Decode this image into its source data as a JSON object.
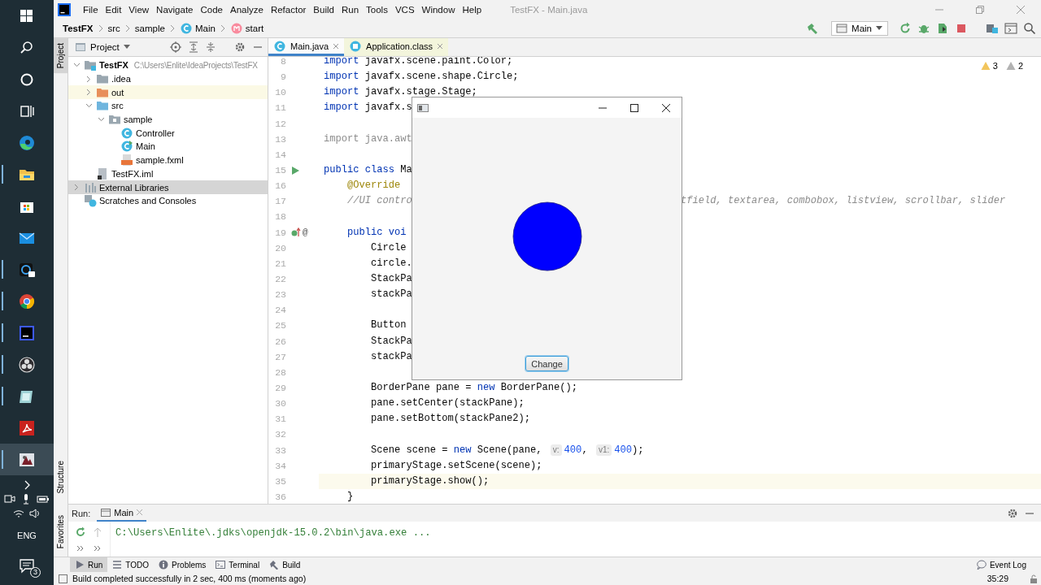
{
  "taskbar": {
    "items": [
      {
        "kind": "start",
        "running": false,
        "selected": false
      },
      {
        "kind": "search",
        "running": false,
        "selected": false
      },
      {
        "kind": "assistant",
        "running": false,
        "selected": false
      },
      {
        "kind": "task-view",
        "running": false,
        "selected": false
      },
      {
        "kind": "browser-edge",
        "running": false,
        "selected": false
      },
      {
        "kind": "explorer",
        "running": true,
        "selected": false
      },
      {
        "kind": "store",
        "running": false,
        "selected": false
      },
      {
        "kind": "mail",
        "running": false,
        "selected": false
      },
      {
        "kind": "chat",
        "running": true,
        "selected": false
      },
      {
        "kind": "browser-chrome",
        "running": true,
        "selected": false
      },
      {
        "kind": "ide",
        "running": true,
        "selected": false
      },
      {
        "kind": "recorder",
        "running": true,
        "selected": false
      },
      {
        "kind": "notes",
        "running": true,
        "selected": false
      },
      {
        "kind": "pdf",
        "running": false,
        "selected": false
      },
      {
        "kind": "java-app",
        "running": true,
        "selected": true
      }
    ],
    "language": "ENG",
    "notifications": "3"
  },
  "menubar": {
    "menus": [
      "File",
      "Edit",
      "View",
      "Navigate",
      "Code",
      "Analyze",
      "Refactor",
      "Build",
      "Run",
      "Tools",
      "VCS",
      "Window",
      "Help"
    ],
    "title": "TestFX - Main.java"
  },
  "navbar": {
    "breadcrumbs": [
      {
        "kind": "project",
        "label": "TestFX"
      },
      {
        "kind": "folder",
        "label": "src"
      },
      {
        "kind": "folder",
        "label": "sample"
      },
      {
        "kind": "class",
        "label": "Main"
      },
      {
        "kind": "method",
        "label": "start"
      }
    ],
    "run_config": "Main"
  },
  "left_stripe": [
    {
      "label": "Project",
      "selected": true
    },
    {
      "label": "Structure",
      "selected": false
    },
    {
      "label": "Favorites",
      "selected": false
    }
  ],
  "project": {
    "title": "Project",
    "tree": [
      {
        "kind": "module",
        "label": "TestFX",
        "path": "C:\\Users\\Enlite\\IdeaProjects\\TestFX",
        "expanded": true,
        "selected": false,
        "children": [
          {
            "kind": "folder",
            "label": ".idea",
            "expanded": false,
            "selected": false
          },
          {
            "kind": "excluded",
            "label": "out",
            "expanded": false,
            "selected": false
          },
          {
            "kind": "source",
            "label": "src",
            "expanded": true,
            "selected": false,
            "children": [
              {
                "kind": "package",
                "label": "sample",
                "expanded": true,
                "selected": false,
                "children": [
                  {
                    "kind": "class",
                    "label": "Controller",
                    "selected": false
                  },
                  {
                    "kind": "main-class",
                    "label": "Main",
                    "selected": false
                  },
                  {
                    "kind": "fxml",
                    "label": "sample.fxml",
                    "selected": false
                  }
                ]
              }
            ]
          },
          {
            "kind": "iml",
            "label": "TestFX.iml",
            "selected": false
          }
        ]
      },
      {
        "kind": "libraries",
        "label": "External Libraries",
        "expanded": false,
        "selected": true
      },
      {
        "kind": "scratches",
        "label": "Scratches and Consoles",
        "selected": false
      }
    ]
  },
  "editor": {
    "tabs": [
      {
        "label": "Main.java",
        "kind": "source",
        "selected": true
      },
      {
        "label": "Application.class",
        "kind": "library",
        "selected": false
      }
    ],
    "inspections": {
      "warnings": "3",
      "weak_warnings": "2"
    },
    "lines": [
      {
        "number": "8",
        "current": false,
        "segments": [
          {
            "kind": "keyword",
            "text": "import"
          },
          {
            "kind": "plain",
            "text": " javafx.scene.paint.Color;"
          }
        ]
      },
      {
        "number": "9",
        "current": false,
        "segments": [
          {
            "kind": "keyword",
            "text": "import"
          },
          {
            "kind": "plain",
            "text": " javafx.scene.shape.Circle;"
          }
        ]
      },
      {
        "number": "10",
        "current": false,
        "segments": [
          {
            "kind": "keyword",
            "text": "import"
          },
          {
            "kind": "plain",
            "text": " javafx.stage.Stage;"
          }
        ]
      },
      {
        "number": "11",
        "current": false,
        "segments": [
          {
            "kind": "keyword",
            "text": "import"
          },
          {
            "kind": "plain",
            "text": " javafx.s"
          }
        ]
      },
      {
        "number": "12",
        "current": false
      },
      {
        "number": "13",
        "current": false,
        "segments": [
          {
            "kind": "unused",
            "text": "import java.awt"
          }
        ]
      },
      {
        "number": "14",
        "current": false
      },
      {
        "number": "15",
        "current": false,
        "gutter": {
          "kind": "run"
        },
        "segments": [
          {
            "kind": "keyword",
            "text": "public class"
          },
          {
            "kind": "plain",
            "text": " Ma"
          }
        ]
      },
      {
        "number": "16",
        "current": false,
        "segments": [
          {
            "kind": "annotation",
            "text": "    @Override"
          }
        ]
      },
      {
        "number": "17",
        "current": false,
        "segments": [
          {
            "kind": "comment",
            "text": "    //UI contro"
          }
        ],
        "right_text": "tfield, textarea, combobox, listview, scrollbar, slider"
      },
      {
        "number": "18",
        "current": false
      },
      {
        "number": "19",
        "current": false,
        "gutter": {
          "kind": "override",
          "text": "@"
        },
        "segments": [
          {
            "kind": "keyword",
            "text": "    public voi"
          }
        ]
      },
      {
        "number": "20",
        "current": false,
        "segments": [
          {
            "kind": "plain",
            "text": "        Circle"
          }
        ]
      },
      {
        "number": "21",
        "current": false,
        "segments": [
          {
            "kind": "plain",
            "text": "        circle."
          }
        ]
      },
      {
        "number": "22",
        "current": false,
        "segments": [
          {
            "kind": "plain",
            "text": "        StackPa"
          }
        ]
      },
      {
        "number": "23",
        "current": false,
        "segments": [
          {
            "kind": "plain",
            "text": "        stackPa"
          }
        ]
      },
      {
        "number": "24",
        "current": false
      },
      {
        "number": "25",
        "current": false,
        "segments": [
          {
            "kind": "plain",
            "text": "        Button"
          }
        ]
      },
      {
        "number": "26",
        "current": false,
        "segments": [
          {
            "kind": "plain",
            "text": "        StackPa"
          }
        ]
      },
      {
        "number": "27",
        "current": false,
        "segments": [
          {
            "kind": "plain",
            "text": "        stackPa"
          }
        ]
      },
      {
        "number": "28",
        "current": false
      },
      {
        "number": "29",
        "current": false,
        "segments": [
          {
            "kind": "plain",
            "text": "        BorderPane pane = "
          },
          {
            "kind": "keyword",
            "text": "new"
          },
          {
            "kind": "plain",
            "text": " BorderPane();"
          }
        ]
      },
      {
        "number": "30",
        "current": false,
        "segments": [
          {
            "kind": "plain",
            "text": "        pane.setCenter(stackPane);"
          }
        ]
      },
      {
        "number": "31",
        "current": false,
        "segments": [
          {
            "kind": "plain",
            "text": "        pane.setBottom(stackPane2);"
          }
        ]
      },
      {
        "number": "32",
        "current": false
      },
      {
        "number": "33",
        "current": false,
        "segments": [
          {
            "kind": "plain",
            "text": "        Scene scene = "
          },
          {
            "kind": "keyword",
            "text": "new"
          },
          {
            "kind": "plain",
            "text": " Scene(pane, "
          },
          {
            "kind": "hint",
            "text": "v:"
          },
          {
            "kind": "number",
            "text": "400"
          },
          {
            "kind": "plain",
            "text": ", "
          },
          {
            "kind": "hint",
            "text": "v1:"
          },
          {
            "kind": "number",
            "text": "400"
          },
          {
            "kind": "plain",
            "text": ");"
          }
        ]
      },
      {
        "number": "34",
        "current": false,
        "segments": [
          {
            "kind": "plain",
            "text": "        primaryStage.setScene(scene);"
          }
        ]
      },
      {
        "number": "35",
        "current": true,
        "segments": [
          {
            "kind": "plain",
            "text": "        primaryStage.show();"
          }
        ]
      },
      {
        "number": "36",
        "current": false,
        "segments": [
          {
            "kind": "plain",
            "text": "    }"
          }
        ]
      }
    ]
  },
  "app_window": {
    "button": "Change"
  },
  "run_panel": {
    "label": "Run:",
    "tab": "Main",
    "output": "C:\\Users\\Enlite\\.jdks\\openjdk-15.0.2\\bin\\java.exe ..."
  },
  "tool_strip": {
    "left": [
      {
        "kind": "run",
        "label": "Run",
        "selected": true
      },
      {
        "kind": "todo",
        "label": "TODO",
        "selected": false
      },
      {
        "kind": "problems",
        "label": "Problems",
        "selected": false
      },
      {
        "kind": "terminal",
        "label": "Terminal",
        "selected": false
      },
      {
        "kind": "build",
        "label": "Build",
        "selected": false
      }
    ],
    "right": [
      {
        "kind": "event-log",
        "label": "Event Log",
        "selected": false
      }
    ]
  },
  "status_bar": {
    "message": "Build completed successfully in 2 sec, 400 ms (moments ago)",
    "position": "35:29"
  }
}
